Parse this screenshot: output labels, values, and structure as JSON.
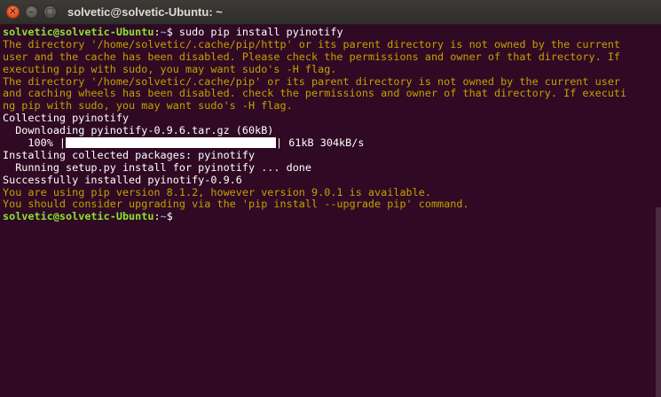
{
  "window": {
    "title": "solvetic@solvetic-Ubuntu: ~",
    "close_glyph": "✕",
    "minimize_glyph": "–",
    "maximize_glyph": "□"
  },
  "colors": {
    "background": "#300a24",
    "prompt_user": "#8ae234",
    "prompt_path": "#729fcf",
    "warning": "#c4a000",
    "text": "#ffffff"
  },
  "terminal": {
    "prompt_user_host": "solvetic@solvetic-Ubuntu",
    "prompt_colon": ":",
    "prompt_path": "~",
    "prompt_symbol": "$ ",
    "command": "sudo pip install pyinotify",
    "warnings_1": [
      "The directory '/home/solvetic/.cache/pip/http' or its parent directory is not owned by the current",
      "user and the cache has been disabled. Please check the permissions and owner of that directory. If",
      "executing pip with sudo, you may want sudo's -H flag.",
      "The directory '/home/solvetic/.cache/pip' or its parent directory is not owned by the current user",
      "and caching wheels has been disabled. check the permissions and owner of that directory. If executi",
      "ng pip with sudo, you may want sudo's -H flag."
    ],
    "collecting": "Collecting pyinotify",
    "downloading": "  Downloading pyinotify-0.9.6.tar.gz (60kB)",
    "progress": {
      "percent_label": "    100% |",
      "value": 100,
      "stats": "| 61kB 304kB/s"
    },
    "installing": "Installing collected packages: pyinotify",
    "running_setup": "  Running setup.py install for pyinotify ... done",
    "success": "Successfully installed pyinotify-0.9.6",
    "warnings_2": [
      "You are using pip version 8.1.2, however version 9.0.1 is available.",
      "You should consider upgrading via the 'pip install --upgrade pip' command."
    ]
  }
}
